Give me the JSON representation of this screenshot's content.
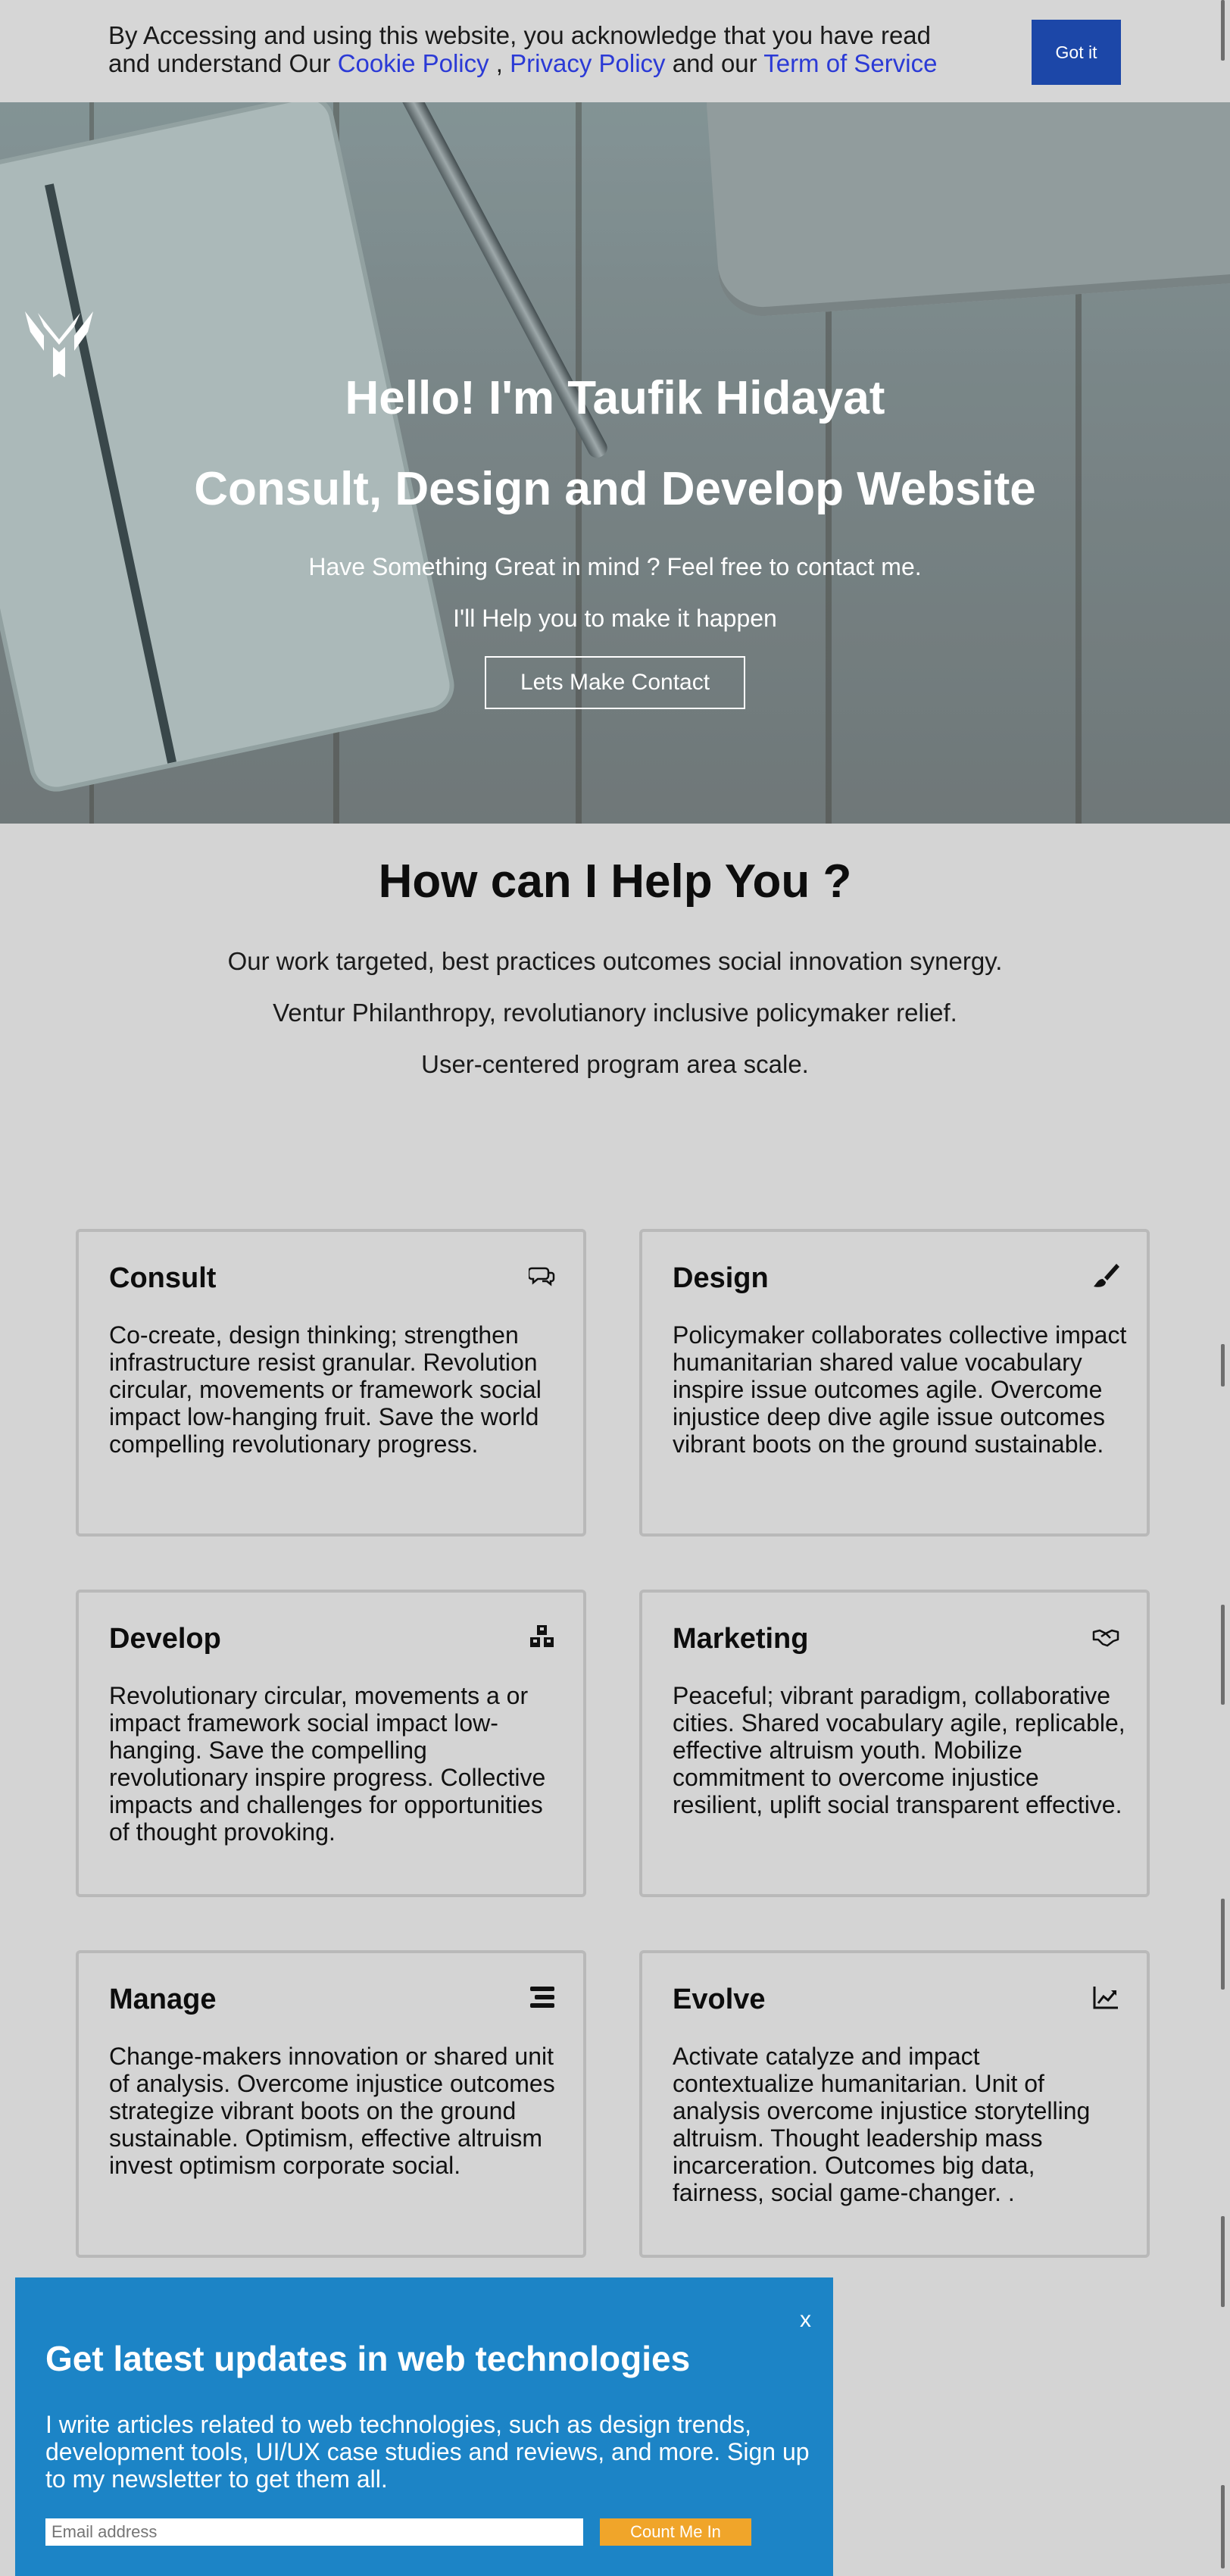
{
  "cookie": {
    "text_before": "By Accessing and using this website, you acknowledge that you have read and understand Our ",
    "cookie_policy": "Cookie Policy",
    "sep1": " , ",
    "privacy_policy": "Privacy Policy",
    "sep2": " and our ",
    "terms": "Term of Service",
    "button": "Got it"
  },
  "hero": {
    "title": "Hello! I'm Taufik Hidayat",
    "subtitle": "Consult, Design and Develop Website",
    "line1": "Have Something Great in mind ? Feel free to contact me.",
    "line2": "I'll Help you to make it happen",
    "button": "Lets Make Contact"
  },
  "help": {
    "title": "How can I Help You ?",
    "paragraphs": [
      "Our work targeted, best practices outcomes social innovation synergy.",
      "Ventur Philanthropy, revolutianory inclusive policymaker relief.",
      "User-centered program area scale."
    ]
  },
  "services": [
    {
      "title": "Consult",
      "icon": "chat-bubbles-icon",
      "body": "Co-create, design thinking; strengthen infrastructure resist granular. Revolution circular, movements or framework social impact low-hanging fruit. Save the world compelling revolutionary progress."
    },
    {
      "title": "Design",
      "icon": "paint-brush-icon",
      "body": "Policymaker collaborates collective impact humanitarian shared value vocabulary inspire issue outcomes agile. Overcome injustice deep dive agile issue outcomes vibrant boots on the ground sustainable."
    },
    {
      "title": "Develop",
      "icon": "cubes-icon",
      "body": "Revolutionary circular, movements a or impact framework social impact low-hanging. Save the compelling revolutionary inspire progress. Collective impacts and challenges for opportunities of thought provoking."
    },
    {
      "title": "Marketing",
      "icon": "handshake-icon",
      "body": "Peaceful; vibrant paradigm, collaborative cities. Shared vocabulary agile, replicable, effective altruism youth. Mobilize commitment to overcome injustice resilient, uplift social transparent effective."
    },
    {
      "title": "Manage",
      "icon": "list-icon",
      "body": "Change-makers innovation or shared unit of analysis. Overcome injustice outcomes strategize vibrant boots on the ground sustainable. Optimism, effective altruism invest optimism corporate social."
    },
    {
      "title": "Evolve",
      "icon": "chart-line-icon",
      "body": "Activate catalyze and impact contextualize humanitarian. Unit of analysis overcome injustice storytelling altruism. Thought leadership mass incarceration. Outcomes big data, fairness, social game-changer. ."
    }
  ],
  "newsletter": {
    "close": "x",
    "title": "Get latest updates in web technologies",
    "text": "I write articles related to web technologies, such as design trends, development tools, UI/UX case studies and reviews, and more. Sign up to my newsletter to get them all.",
    "placeholder": "Email address",
    "button": "Count Me In"
  }
}
